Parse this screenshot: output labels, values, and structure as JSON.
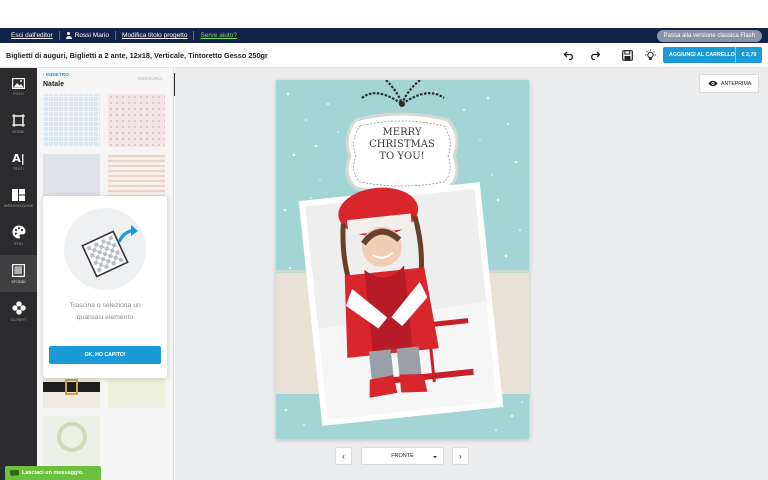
{
  "nav": {
    "exit_editor": "Esci dall'editor",
    "user_name": "Rossi Mario",
    "edit_title": "Modifica titolo progetto",
    "help": "Serve aiuto?",
    "classic_version": "Passa alla versione classica Flash"
  },
  "toolbar": {
    "project_title": "Biglietti di auguri, Biglietti a 2 ante, 12x18, Verticale, Tintoretto Gesso 250gr",
    "undo_icon": "undo-icon",
    "redo_icon": "redo-icon",
    "save_icon": "save-icon",
    "tips_icon": "lightbulb-icon",
    "add_to_cart": "AGGIUNGI AL CARRELLO",
    "price": "€ 2,79",
    "accent_color": "#1b9ad8"
  },
  "rail": {
    "items": [
      {
        "label": "FOTO",
        "icon": "photo-icon"
      },
      {
        "label": "BORDI",
        "icon": "border-icon"
      },
      {
        "label": "TESTI",
        "icon": "text-icon"
      },
      {
        "label": "IMPAGINAZIONE",
        "icon": "layout-icon"
      },
      {
        "label": "STILI",
        "icon": "palette-icon"
      },
      {
        "label": "SFONDI",
        "icon": "background-icon"
      },
      {
        "label": "CLIPART",
        "icon": "clipart-icon"
      }
    ],
    "active": "SFONDI"
  },
  "panel": {
    "back": "INDIETRO",
    "reset": "RESSUNO",
    "title": "Natale"
  },
  "tooltip": {
    "text": "Trascina o seleziona un qualsiasi elemento",
    "button": "OK, HO CAPITO!"
  },
  "canvas": {
    "preview": "ANTEPRIMA",
    "card_text": [
      "MERRY",
      "CHRISTMAS",
      "TO YOU!"
    ],
    "card_background": "#a2d5d3",
    "page_select": "FRONTE"
  },
  "chat": {
    "label": "Lasciaci un messaggio."
  }
}
